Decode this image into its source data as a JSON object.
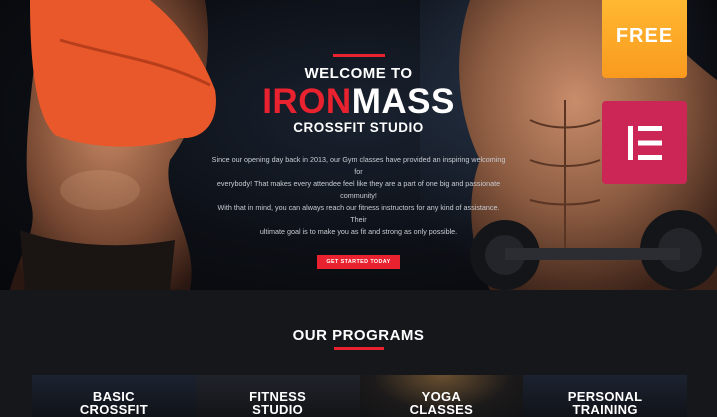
{
  "hero": {
    "welcome": "WELCOME TO",
    "brand_red": "IRON",
    "brand_white": "MASS",
    "subtitle": "CROSSFIT STUDIO",
    "intro_lines": [
      "Since our opening day back in 2013, our Gym classes have provided an inspiring welcoming for",
      "everybody! That makes every attendee feel like they are a part of one big and passionate community!",
      "With that in mind, you can always reach our fitness instructors for any kind of assistance. Their",
      "ultimate goal is to make you as fit and strong as only possible."
    ],
    "cta_label": "GET STARTED TODAY"
  },
  "badges": {
    "free_label": "FREE",
    "elementor_icon": "elementor-icon"
  },
  "programs": {
    "title": "OUR PROGRAMS",
    "cards": [
      {
        "line1": "BASIC",
        "line2": "CROSSFIT"
      },
      {
        "line1": "FITNESS",
        "line2": "STUDIO"
      },
      {
        "line1": "YOGA",
        "line2": "CLASSES"
      },
      {
        "line1": "PERSONAL",
        "line2": "TRAINING"
      }
    ]
  },
  "colors": {
    "accent": "#e8222e",
    "free_badge": "#f9a825",
    "elementor_badge": "#cc2656",
    "dark_bg": "#15171b"
  }
}
